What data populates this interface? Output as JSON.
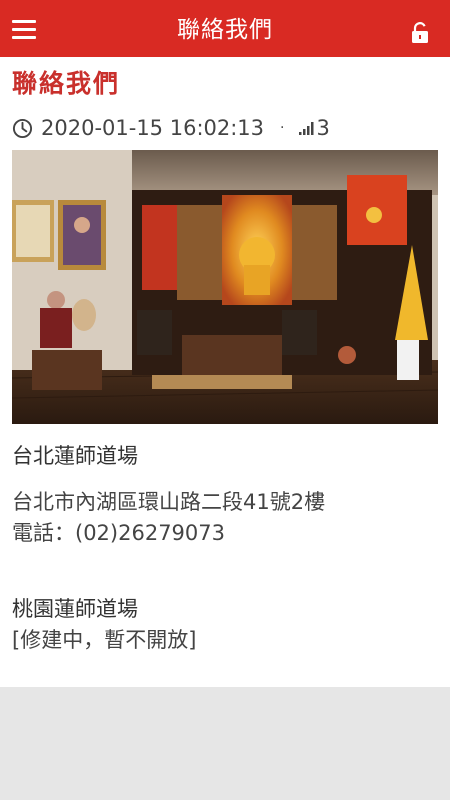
{
  "header": {
    "title": "聯絡我們",
    "menu_icon": "hamburger-menu-icon",
    "lock_icon": "unlock-icon",
    "color": "#d92a23"
  },
  "article": {
    "title": "聯絡我們",
    "datetime": "2020-01-15 16:02:13",
    "separator": "·",
    "views": "3",
    "title_color": "#c9302c"
  },
  "locations": [
    {
      "name": "台北蓮師道場",
      "address": "台北市內湖區環山路二段41號2樓",
      "phone": "電話：(02)26279073"
    },
    {
      "name": "桃園蓮師道場",
      "status": "[修建中，暫不開放]"
    }
  ]
}
